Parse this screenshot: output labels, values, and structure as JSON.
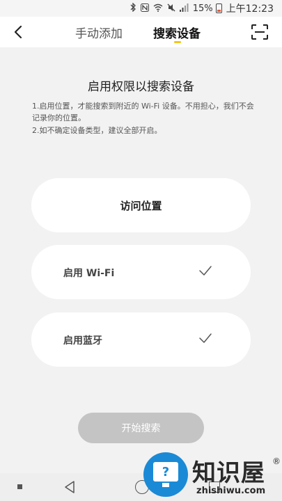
{
  "status_bar": {
    "icons": [
      "bluetooth-icon",
      "nfc-icon",
      "wifi-icon",
      "mute-icon",
      "signal-icon"
    ],
    "battery": "15%",
    "time": "上午12:23"
  },
  "header": {
    "tabs": [
      {
        "label": "手动添加",
        "active": false
      },
      {
        "label": "搜索设备",
        "active": true
      }
    ],
    "accent_color": "#f5c518"
  },
  "main": {
    "title": "启用权限以搜索设备",
    "desc_1": "1.启用位置，才能搜索到附近的 Wi-Fi 设备。不用担心，我们不会记录你的位置。",
    "desc_2": "2.如不确定设备类型，建议全部开启。",
    "permissions": [
      {
        "label": "访问位置",
        "checked": false
      },
      {
        "label": "启用 Wi-Fi",
        "checked": true
      },
      {
        "label": "启用蓝牙",
        "checked": true
      }
    ],
    "start_button": "开始搜索"
  },
  "watermark": {
    "text": "知识屋",
    "url": "zhishiwu.com",
    "reg": "®",
    "glyph": "?"
  }
}
